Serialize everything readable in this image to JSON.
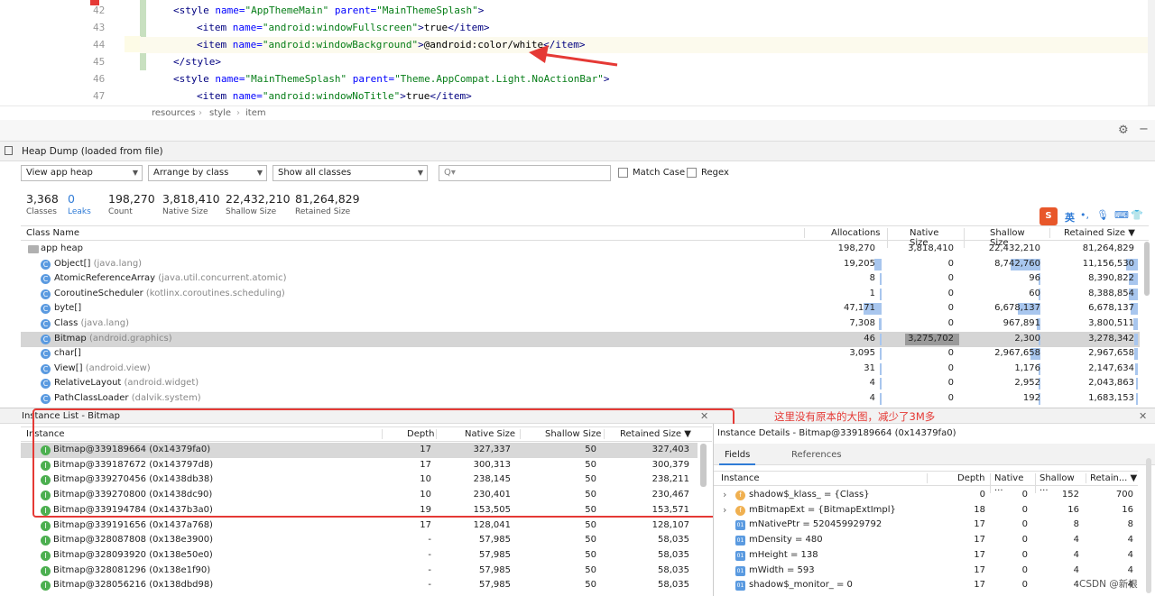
{
  "editor": {
    "lines": [
      {
        "num": "42",
        "indent": 0,
        "parts": [
          [
            "tag",
            "<style "
          ],
          [
            "attr",
            "name="
          ],
          [
            "val",
            "\"AppThemeMain\" "
          ],
          [
            "attr",
            "parent="
          ],
          [
            "val",
            "\"MainThemeSplash\""
          ],
          [
            "tag",
            ">"
          ]
        ]
      },
      {
        "num": "43",
        "indent": 1,
        "parts": [
          [
            "tag",
            "<item "
          ],
          [
            "attr",
            "name="
          ],
          [
            "val",
            "\"android:windowFullscreen\""
          ],
          [
            "tag",
            ">"
          ],
          [
            "txt",
            "true"
          ],
          [
            "tag",
            "</item>"
          ]
        ]
      },
      {
        "num": "44",
        "indent": 1,
        "parts": [
          [
            "tag",
            "<item "
          ],
          [
            "attr",
            "name="
          ],
          [
            "val",
            "\"android:windowBackground\""
          ],
          [
            "tag",
            ">"
          ],
          [
            "txt",
            "@android:color/white"
          ],
          [
            "tag",
            "</item>"
          ]
        ]
      },
      {
        "num": "45",
        "indent": 0,
        "parts": [
          [
            "tag",
            "</style>"
          ]
        ]
      },
      {
        "num": "46",
        "indent": 0,
        "parts": [
          [
            "tag",
            "<style "
          ],
          [
            "attr",
            "name="
          ],
          [
            "val",
            "\"MainThemeSplash\" "
          ],
          [
            "attr",
            "parent="
          ],
          [
            "val",
            "\"Theme.AppCompat.Light.NoActionBar\""
          ],
          [
            "tag",
            ">"
          ]
        ]
      },
      {
        "num": "47",
        "indent": 1,
        "parts": [
          [
            "tag",
            "<item "
          ],
          [
            "attr",
            "name="
          ],
          [
            "val",
            "\"android:windowNoTitle\""
          ],
          [
            "tag",
            ">"
          ],
          [
            "txt",
            "true"
          ],
          [
            "tag",
            "</item>"
          ]
        ]
      }
    ],
    "breadcrumb": [
      "resources",
      "style",
      "item"
    ]
  },
  "heap": {
    "title": "Heap Dump (loaded from file)",
    "view_select": "View app heap",
    "arrange_select": "Arrange by class",
    "show_select": "Show all classes",
    "search_placeholder": "Q▾",
    "match_case": "Match Case",
    "regex": "Regex",
    "stats": [
      {
        "num": "3,368",
        "label": "Classes"
      },
      {
        "num": "0",
        "label": "Leaks"
      },
      {
        "num": "198,270",
        "label": "Count"
      },
      {
        "num": "3,818,410",
        "label": "Native Size"
      },
      {
        "num": "22,432,210",
        "label": "Shallow Size"
      },
      {
        "num": "81,264,829",
        "label": "Retained Size"
      }
    ],
    "class_columns": [
      "Class Name",
      "Allocations",
      "Native Size",
      "Shallow Size",
      "Retained Size ▼"
    ],
    "classes": [
      {
        "name": "app heap",
        "pkg": "",
        "alloc": "198,270",
        "native": "3,818,410",
        "shallow": "22,432,210",
        "retained": "81,264,829",
        "root": true
      },
      {
        "name": "Object[]",
        "pkg": "(java.lang)",
        "alloc": "19,205",
        "native": "0",
        "shallow": "8,742,760",
        "retained": "11,156,530"
      },
      {
        "name": "AtomicReferenceArray",
        "pkg": "(java.util.concurrent.atomic)",
        "alloc": "8",
        "native": "0",
        "shallow": "96",
        "retained": "8,390,822"
      },
      {
        "name": "CoroutineScheduler",
        "pkg": "(kotlinx.coroutines.scheduling)",
        "alloc": "1",
        "native": "0",
        "shallow": "60",
        "retained": "8,388,854"
      },
      {
        "name": "byte[]",
        "pkg": "",
        "alloc": "47,171",
        "native": "0",
        "shallow": "6,678,137",
        "retained": "6,678,137"
      },
      {
        "name": "Class",
        "pkg": "(java.lang)",
        "alloc": "7,308",
        "native": "0",
        "shallow": "967,891",
        "retained": "3,800,511"
      },
      {
        "name": "Bitmap",
        "pkg": "(android.graphics)",
        "alloc": "46",
        "native": "3,275,702",
        "shallow": "2,300",
        "retained": "3,278,342",
        "selected": true
      },
      {
        "name": "char[]",
        "pkg": "",
        "alloc": "3,095",
        "native": "0",
        "shallow": "2,967,658",
        "retained": "2,967,658"
      },
      {
        "name": "View[]",
        "pkg": "(android.view)",
        "alloc": "31",
        "native": "0",
        "shallow": "1,176",
        "retained": "2,147,634"
      },
      {
        "name": "RelativeLayout",
        "pkg": "(android.widget)",
        "alloc": "4",
        "native": "0",
        "shallow": "2,952",
        "retained": "2,043,863"
      },
      {
        "name": "PathClassLoader",
        "pkg": "(dalvik.system)",
        "alloc": "4",
        "native": "0",
        "shallow": "192",
        "retained": "1,683,153"
      }
    ]
  },
  "instances": {
    "title": "Instance List - Bitmap",
    "columns": [
      "Instance",
      "Depth",
      "Native Size",
      "Shallow Size",
      "Retained Size ▼"
    ],
    "rows": [
      {
        "name": "Bitmap@339189664 (0x14379fa0)",
        "depth": "17",
        "native": "327,337",
        "shallow": "50",
        "retained": "327,403",
        "selected": true
      },
      {
        "name": "Bitmap@339187672 (0x143797d8)",
        "depth": "17",
        "native": "300,313",
        "shallow": "50",
        "retained": "300,379"
      },
      {
        "name": "Bitmap@339270456 (0x1438db38)",
        "depth": "10",
        "native": "238,145",
        "shallow": "50",
        "retained": "238,211"
      },
      {
        "name": "Bitmap@339270800 (0x1438dc90)",
        "depth": "10",
        "native": "230,401",
        "shallow": "50",
        "retained": "230,467"
      },
      {
        "name": "Bitmap@339194784 (0x1437b3a0)",
        "depth": "19",
        "native": "153,505",
        "shallow": "50",
        "retained": "153,571"
      },
      {
        "name": "Bitmap@339191656 (0x1437a768)",
        "depth": "17",
        "native": "128,041",
        "shallow": "50",
        "retained": "128,107"
      },
      {
        "name": "Bitmap@328087808 (0x138e3900)",
        "depth": "-",
        "native": "57,985",
        "shallow": "50",
        "retained": "58,035"
      },
      {
        "name": "Bitmap@328093920 (0x138e50e0)",
        "depth": "-",
        "native": "57,985",
        "shallow": "50",
        "retained": "58,035"
      },
      {
        "name": "Bitmap@328081296 (0x138e1f90)",
        "depth": "-",
        "native": "57,985",
        "shallow": "50",
        "retained": "58,035"
      },
      {
        "name": "Bitmap@328056216 (0x138dbd98)",
        "depth": "-",
        "native": "57,985",
        "shallow": "50",
        "retained": "58,035"
      }
    ],
    "annotation": "这里没有原本的大图，减少了3M多"
  },
  "details": {
    "title": "Instance Details - Bitmap@339189664 (0x14379fa0)",
    "tabs": [
      "Fields",
      "References"
    ],
    "columns": [
      "Instance",
      "Depth",
      "Native ...",
      "Shallow ...",
      "Retain... ▼"
    ],
    "rows": [
      {
        "name": "shadow$_klass_ = {Class}",
        "depth": "0",
        "native": "0",
        "shallow": "152",
        "retained": "700",
        "kind": "f",
        "expand": true
      },
      {
        "name": "mBitmapExt = {BitmapExtImpl}",
        "depth": "18",
        "native": "0",
        "shallow": "16",
        "retained": "16",
        "kind": "f",
        "expand": true
      },
      {
        "name": "mNativePtr = 520459929792",
        "depth": "17",
        "native": "0",
        "shallow": "8",
        "retained": "8",
        "kind": "p"
      },
      {
        "name": "mDensity = 480",
        "depth": "17",
        "native": "0",
        "shallow": "4",
        "retained": "4",
        "kind": "p"
      },
      {
        "name": "mHeight = 138",
        "depth": "17",
        "native": "0",
        "shallow": "4",
        "retained": "4",
        "kind": "p"
      },
      {
        "name": "mWidth = 593",
        "depth": "17",
        "native": "0",
        "shallow": "4",
        "retained": "4",
        "kind": "p"
      },
      {
        "name": "shadow$_monitor_ = 0",
        "depth": "17",
        "native": "0",
        "shallow": "4",
        "retained": "4",
        "kind": "p"
      }
    ]
  },
  "ime": {
    "lang": "英"
  },
  "watermark": "CSDN @新根",
  "colors": {
    "accent": "#2f7bd6",
    "annotation": "#e53935",
    "bar": "#a8c6ee"
  }
}
